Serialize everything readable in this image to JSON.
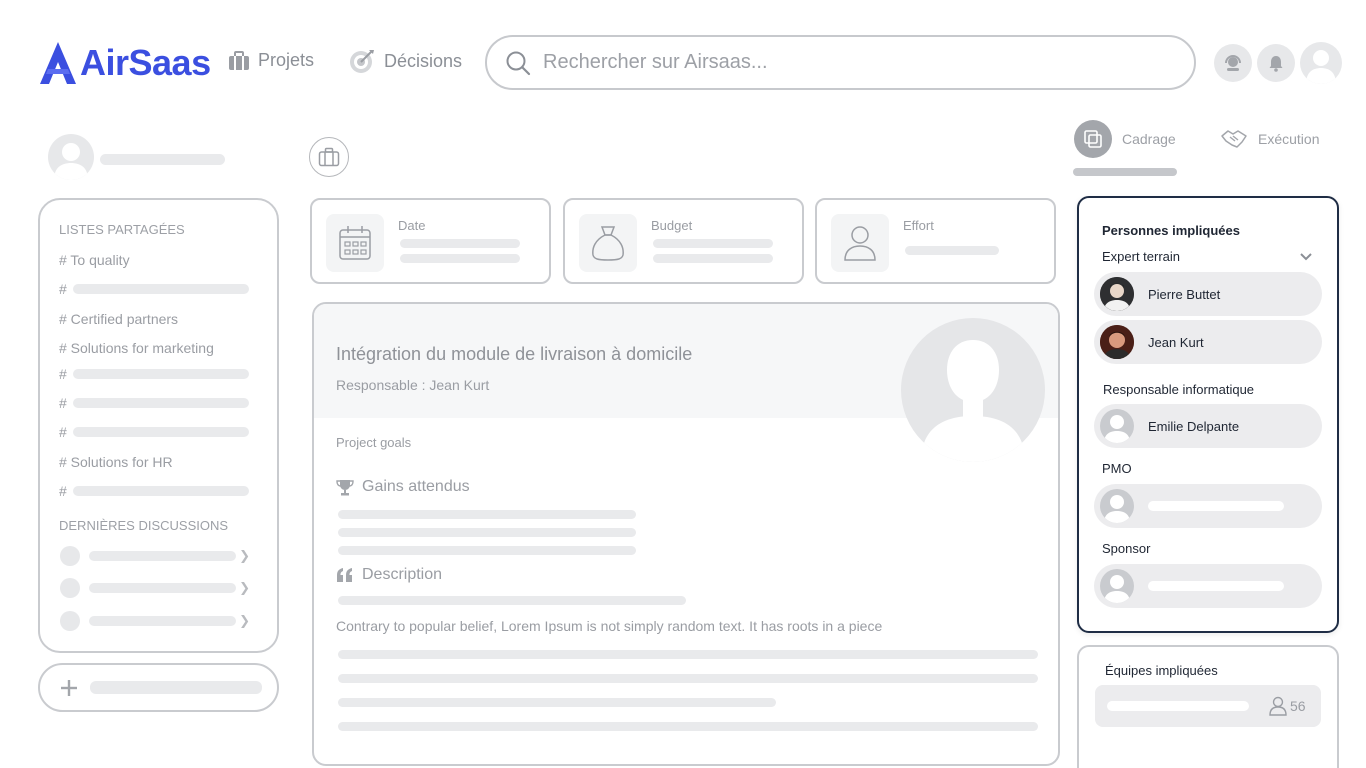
{
  "brand": {
    "name": "AirSaas",
    "color": "#3b4fe0"
  },
  "nav": {
    "projects": "Projets",
    "decisions": "Décisions"
  },
  "search": {
    "placeholder": "Rechercher sur Airsaas..."
  },
  "sidebar": {
    "shared_lists_title": "LISTES PARTAGÉES",
    "items": [
      {
        "label": "# To quality"
      },
      {
        "label": "#"
      },
      {
        "label": "# Certified partners"
      },
      {
        "label": "# Solutions for marketing"
      },
      {
        "label": "#"
      },
      {
        "label": "#"
      },
      {
        "label": "#"
      },
      {
        "label": "# Solutions for HR"
      },
      {
        "label": "#"
      }
    ],
    "discussions_title": "DERNIÈRES DISCUSSIONS"
  },
  "cards": {
    "date": "Date",
    "budget": "Budget",
    "effort": "Effort"
  },
  "project": {
    "title": "Intégration du module de livraison à domicile",
    "responsible": "Responsable : Jean Kurt",
    "goals_label": "Project goals",
    "gains_label": "Gains attendus",
    "description_label": "Description",
    "description_text": "Contrary to popular belief, Lorem Ipsum is not simply random text. It has roots in a piece"
  },
  "tabs": {
    "cadrage": "Cadrage",
    "execution": "Exécution"
  },
  "people": {
    "title": "Personnes impliquées",
    "expert_role": "Expert terrain",
    "experts": [
      "Pierre Buttet",
      "Jean Kurt"
    ],
    "it_role": "Responsable informatique",
    "it_person": "Emilie Delpante",
    "pmo_role": "PMO",
    "sponsor_role": "Sponsor"
  },
  "teams": {
    "title": "Équipes impliquées",
    "count": "56"
  }
}
